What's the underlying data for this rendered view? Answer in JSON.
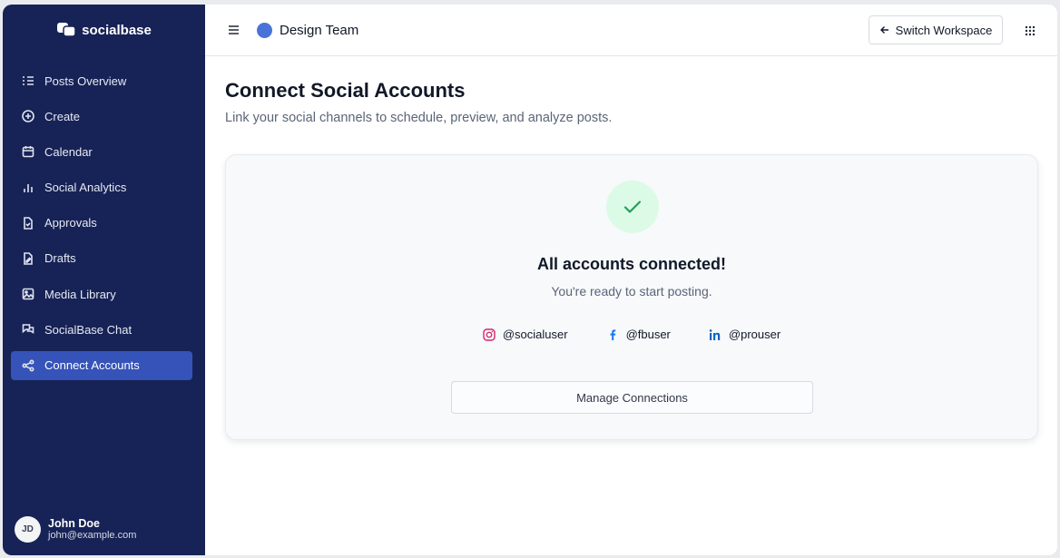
{
  "brand": {
    "name": "socialbase"
  },
  "sidebar": {
    "items": [
      {
        "label": "Posts Overview",
        "icon": "list-icon"
      },
      {
        "label": "Create",
        "icon": "plus-circle-icon"
      },
      {
        "label": "Calendar",
        "icon": "calendar-icon"
      },
      {
        "label": "Social Analytics",
        "icon": "bar-chart-icon"
      },
      {
        "label": "Approvals",
        "icon": "file-check-icon"
      },
      {
        "label": "Drafts",
        "icon": "file-edit-icon"
      },
      {
        "label": "Media Library",
        "icon": "image-icon"
      },
      {
        "label": "SocialBase Chat",
        "icon": "chat-icon"
      },
      {
        "label": "Connect Accounts",
        "icon": "share-icon",
        "active": true
      }
    ]
  },
  "user": {
    "initials": "JD",
    "name": "John Doe",
    "email": "john@example.com"
  },
  "topbar": {
    "team_name": "Design Team",
    "switch_label": "Switch Workspace"
  },
  "page": {
    "title": "Connect Social Accounts",
    "subtitle": "Link your social channels to schedule, preview, and analyze posts."
  },
  "card": {
    "title": "All accounts connected!",
    "subtitle": "You're ready to start posting.",
    "accounts": [
      {
        "platform_icon": "instagram-icon",
        "handle": "@socialuser",
        "color": "#d6246e"
      },
      {
        "platform_icon": "facebook-icon",
        "handle": "@fbuser",
        "color": "#1877f2"
      },
      {
        "platform_icon": "linkedin-icon",
        "handle": "@prouser",
        "color": "#0a66c2"
      }
    ],
    "manage_label": "Manage Connections"
  },
  "colors": {
    "sidebar": "#172356",
    "active": "#3553b8",
    "success_bg": "#dcfbe6",
    "success": "#22a05a"
  }
}
